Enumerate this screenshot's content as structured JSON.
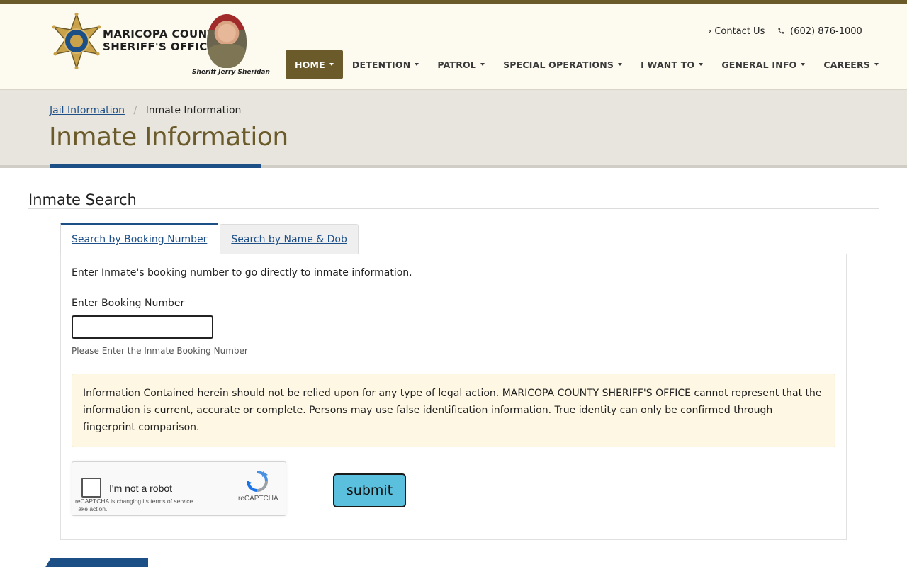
{
  "colors": {
    "brand_gold": "#6b5a2a",
    "link_blue": "#1e4f86",
    "accent_blue": "#1d4f87",
    "submit_bg": "#5bc0de",
    "notice_bg": "#fdf7e3"
  },
  "header": {
    "logo_line1": "MARICOPA COUNTY",
    "logo_line2": "SHERIFF'S OFFICE",
    "sheriff_caption": "Sheriff Jerry Sheridan",
    "contact_label": "Contact Us",
    "phone": "(602) 876-1000",
    "nav": [
      {
        "label": "HOME",
        "active": true
      },
      {
        "label": "DETENTION"
      },
      {
        "label": "PATROL"
      },
      {
        "label": "SPECIAL OPERATIONS"
      },
      {
        "label": "I WANT TO"
      },
      {
        "label": "GENERAL INFO"
      },
      {
        "label": "CAREERS"
      }
    ]
  },
  "banner": {
    "breadcrumb_parent": "Jail Information",
    "breadcrumb_current": "Inmate Information",
    "title": "Inmate Information"
  },
  "search": {
    "section_title": "Inmate Search",
    "tabs": [
      {
        "label": "Search by Booking Number",
        "active": true
      },
      {
        "label": "Search by Name & Dob",
        "active": false
      }
    ],
    "intro": "Enter Inmate's booking number to go directly to inmate information.",
    "field_label": "Enter Booking Number",
    "field_value": "",
    "field_help": "Please Enter the Inmate Booking Number",
    "notice": "Information Contained herein should not be relied upon for any type of legal action. MARICOPA COUNTY SHERIFF'S OFFICE cannot represent that the information is current, accurate or complete. Persons may use false identification information. True identity can only be confirmed through fingerprint comparison.",
    "submit_label": "submit"
  },
  "recaptcha": {
    "label": "I'm not a robot",
    "brand": "reCAPTCHA",
    "terms_text": "reCAPTCHA is changing its terms of service.",
    "terms_link": "Take action."
  },
  "icons": {
    "badge": "sheriff-star-badge",
    "chevron": "chevron-right-icon",
    "phone": "phone-icon",
    "caret": "caret-down-icon",
    "recaptcha": "recaptcha-logo-icon"
  }
}
